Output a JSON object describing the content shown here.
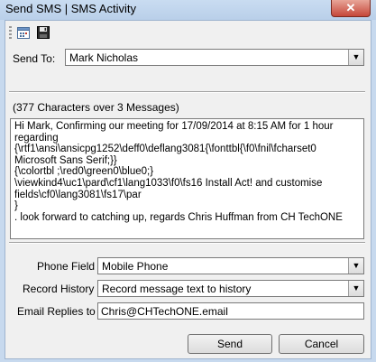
{
  "window": {
    "title": "Send SMS | SMS Activity",
    "close_glyph": "✕"
  },
  "toolbar": {
    "icons": [
      "calendar-icon",
      "save-icon"
    ]
  },
  "send_to": {
    "label": "Send To:",
    "value": "Mark Nicholas"
  },
  "message": {
    "summary": "(377 Characters over 3 Messages)",
    "text": "Hi Mark, Confirming our meeting for 17/09/2014 at 8:15 AM for 1 hour regarding {\\rtf1\\ansi\\ansicpg1252\\deff0\\deflang3081{\\fonttbl{\\f0\\fnil\\fcharset0 Microsoft Sans Serif;}}\n{\\colortbl ;\\red0\\green0\\blue0;}\n\\viewkind4\\uc1\\pard\\cf1\\lang1033\\f0\\fs16 Install Act! and customise fields\\cf0\\lang3081\\fs17\\par\n}\n. look forward to catching up, regards Chris Huffman from CH TechONE"
  },
  "phone_field": {
    "label": "Phone Field",
    "value": "Mobile Phone"
  },
  "record_history": {
    "label": "Record History",
    "value": "Record message text to history"
  },
  "email_replies": {
    "label": "Email Replies to",
    "value": "Chris@CHTechONE.email"
  },
  "buttons": {
    "send": "Send",
    "cancel": "Cancel"
  }
}
